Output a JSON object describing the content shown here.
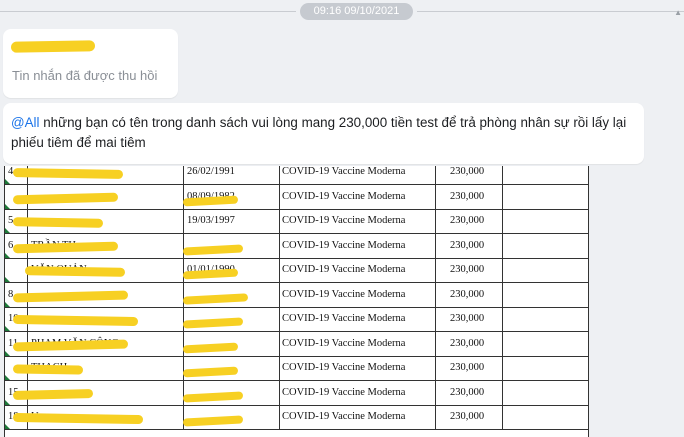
{
  "chat": {
    "timestamp": "09:16 09/10/2021",
    "recalled_message": "Tin nhắn đã được thu hồi",
    "message": {
      "mention": "@All",
      "text": " những bạn có tên trong danh sách vui lòng mang 230,000 tiền test để trả phòng nhân sự rồi lấy lại phiếu tiêm để mai tiêm"
    }
  },
  "sheet": {
    "rows": [
      {
        "idx": "4",
        "name": "",
        "date": "26/02/1991",
        "vaccine": "COVID-19 Vaccine Moderna",
        "amount": "230,000"
      },
      {
        "idx": "",
        "name": "",
        "date": "08/09/1982",
        "vaccine": "COVID-19 Vaccine Moderna",
        "amount": "230,000"
      },
      {
        "idx": "5",
        "name": "",
        "date": "19/03/1997",
        "vaccine": "COVID-19 Vaccine Moderna",
        "amount": "230,000"
      },
      {
        "idx": "6",
        "name": "TRẦN TH",
        "date": "",
        "vaccine": "COVID-19 Vaccine Moderna",
        "amount": "230,000"
      },
      {
        "idx": "",
        "name": "VĂN QUẢN",
        "date": "01/01/1990",
        "vaccine": "COVID-19 Vaccine Moderna",
        "amount": "230,000"
      },
      {
        "idx": "8",
        "name": "",
        "date": "",
        "vaccine": "COVID-19 Vaccine Moderna",
        "amount": "230,000"
      },
      {
        "idx": "10",
        "name": "",
        "date": "",
        "vaccine": "COVID-19 Vaccine Moderna",
        "amount": "230,000"
      },
      {
        "idx": "11",
        "name": "PHẠM VĂN CÔNG",
        "date": "",
        "vaccine": "COVID-19 Vaccine Moderna",
        "amount": "230,000"
      },
      {
        "idx": "",
        "name": "THACH",
        "date": "",
        "vaccine": "COVID-19 Vaccine Moderna",
        "amount": "230,000"
      },
      {
        "idx": "15",
        "name": "",
        "date": "",
        "vaccine": "COVID-19 Vaccine Moderna",
        "amount": "230,000"
      },
      {
        "idx": "18",
        "name": "U",
        "date": "",
        "vaccine": "COVID-19 Vaccine Moderna",
        "amount": "230,000"
      }
    ]
  },
  "colors": {
    "redaction": "#f7d023",
    "mention": "#1a73e8",
    "background": "#eef0f3"
  }
}
